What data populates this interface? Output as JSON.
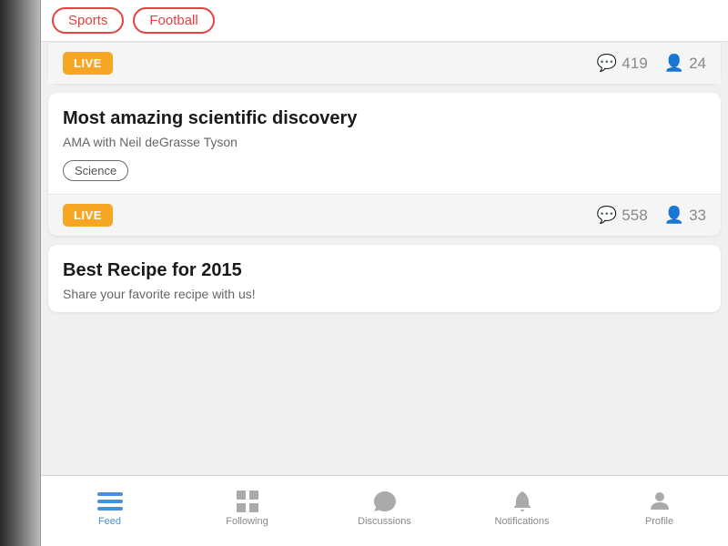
{
  "tags": [
    {
      "label": "Sports",
      "id": "sports"
    },
    {
      "label": "Football",
      "id": "football"
    }
  ],
  "cards": [
    {
      "id": "card1",
      "live": true,
      "live_label": "LIVE",
      "comments": 419,
      "viewers": 24
    },
    {
      "id": "card2",
      "title": "Most amazing scientific discovery",
      "subtitle": "AMA with Neil deGrasse Tyson",
      "tag": "Science",
      "live": true,
      "live_label": "LIVE",
      "comments": 558,
      "viewers": 33
    },
    {
      "id": "card3",
      "title": "Best Recipe for 2015",
      "subtitle": "Share your favorite recipe with us!",
      "live": false
    }
  ],
  "bottom_nav": [
    {
      "id": "feed",
      "label": "Feed",
      "active": true,
      "icon": "feed-icon"
    },
    {
      "id": "following",
      "label": "Following",
      "active": false,
      "icon": "grid-icon"
    },
    {
      "id": "discussions",
      "label": "Discussions",
      "active": false,
      "icon": "chat-icon"
    },
    {
      "id": "notifications",
      "label": "Notifications",
      "active": false,
      "icon": "bell-icon"
    },
    {
      "id": "profile",
      "label": "Profile",
      "active": false,
      "icon": "person-icon"
    }
  ],
  "colors": {
    "live_badge": "#f5a623",
    "tag_pill_color": "#e84040",
    "active_nav": "#4a90d9"
  }
}
